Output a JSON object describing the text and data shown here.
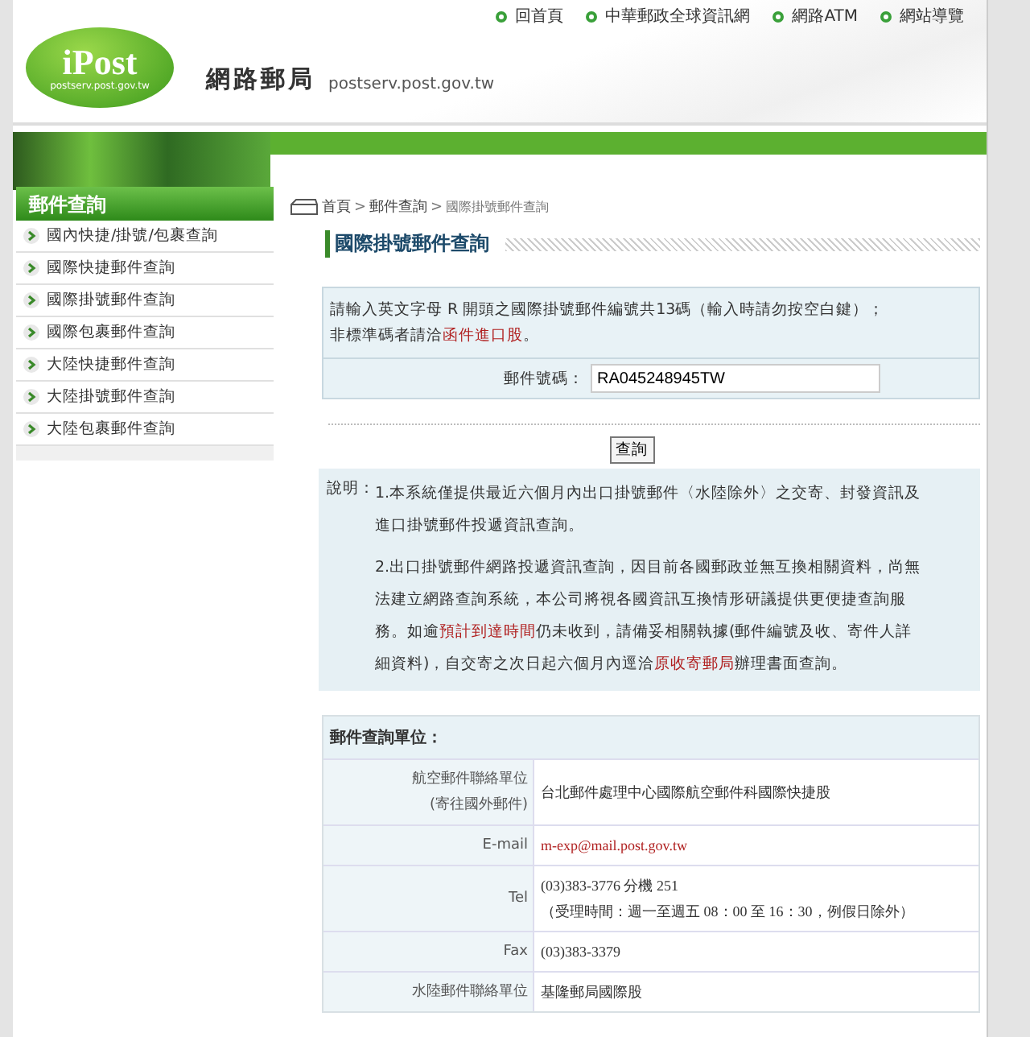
{
  "top_nav": [
    "回首頁",
    "中華郵政全球資訊網",
    "網路ATM",
    "網站導覽"
  ],
  "logo": {
    "brand": "iPost",
    "domain": "postserv.post.gov.tw"
  },
  "site": {
    "title": "網路郵局",
    "domain": "postserv.post.gov.tw"
  },
  "sidebar": {
    "title": "郵件查詢",
    "items": [
      {
        "label": "國內快捷/掛號/包裹查詢"
      },
      {
        "label": "國際快捷郵件查詢"
      },
      {
        "label": "國際掛號郵件查詢"
      },
      {
        "label": "國際包裹郵件查詢"
      },
      {
        "label": "大陸快捷郵件查詢"
      },
      {
        "label": "大陸掛號郵件查詢"
      },
      {
        "label": "大陸包裹郵件查詢"
      }
    ]
  },
  "breadcrumb": [
    "首頁",
    ">",
    "郵件查詢",
    ">",
    "國際掛號郵件查詢"
  ],
  "page_title": "國際掛號郵件查詢",
  "instructions": [
    [
      {
        "text": "請輸入英文字母 R 開頭之國際掛號郵件編號共13碼（輸入時請勿按空白鍵）；"
      }
    ],
    [
      {
        "text": "非標準碼者請洽"
      },
      {
        "text": "函件進口股",
        "link": true
      },
      {
        "text": "。"
      }
    ]
  ],
  "field": {
    "label": "郵件號碼：",
    "value": "RA045248945TW"
  },
  "query_button": "查詢",
  "notes": {
    "label": "說明：",
    "items": [
      [
        {
          "text": "1.本系統僅提供最近六個月內出口掛號郵件〈水陸除外〉之交寄、封發資訊及進口掛號郵件投遞資訊查詢。"
        }
      ],
      [
        {
          "text": "2.出口掛號郵件網路投遞資訊查詢，因目前各國郵政並無互換相關資料，尚無法建立網路查詢系統，本公司將視各國資訊互換情形研議提供更便捷查詢服務。如逾"
        },
        {
          "text": "預計到達時間",
          "link": true
        },
        {
          "text": "仍未收到，請備妥相關執據(郵件編號及收、寄件人詳細資料)，自交寄之次日起六個月內逕洽"
        },
        {
          "text": "原收寄郵局",
          "link": true
        },
        {
          "text": "辦理書面查詢。"
        }
      ]
    ]
  },
  "contacts": {
    "title": "郵件查詢單位：",
    "rows": [
      {
        "label": [
          "航空郵件聯絡單位",
          "(寄往國外郵件)"
        ],
        "kind": "text",
        "value": [
          "台北郵件處理中心國際航空郵件科國際快捷股"
        ]
      },
      {
        "label": [
          "E-mail"
        ],
        "kind": "link",
        "value": [
          "m-exp@mail.post.gov.tw"
        ]
      },
      {
        "label": [
          "Tel"
        ],
        "kind": "text",
        "value": [
          "(03)383-3776 分機 251",
          "（受理時間：週一至週五 08：00 至 16：30，例假日除外）"
        ]
      },
      {
        "label": [
          "Fax"
        ],
        "kind": "text",
        "value": [
          "(03)383-3379"
        ]
      },
      {
        "label": [
          "水陸郵件聯絡單位"
        ],
        "kind": "text",
        "value": [
          "基隆郵局國際股"
        ]
      }
    ]
  }
}
